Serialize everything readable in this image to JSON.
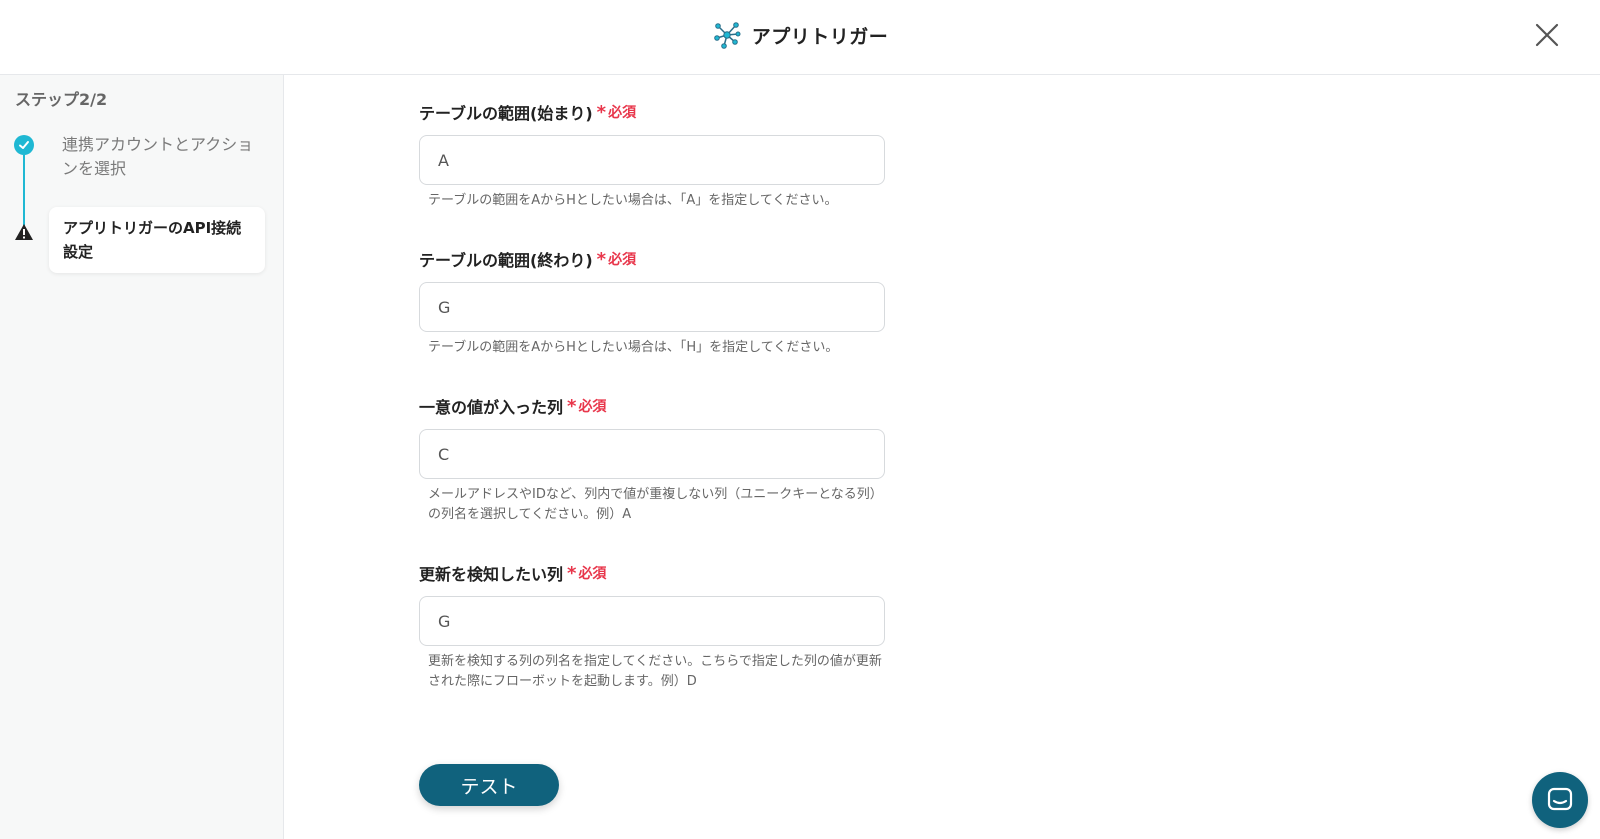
{
  "header": {
    "title": "アプリトリガー",
    "icon": "network-nodes-icon",
    "close_icon": "close-icon"
  },
  "sidebar": {
    "step_label": "ステップ2/2",
    "steps": [
      {
        "label": "連携アカウントとアクションを選択",
        "status": "done",
        "icon": "check-icon"
      },
      {
        "label": "アプリトリガーのAPI接続設定",
        "status": "active",
        "icon": "warning-icon"
      }
    ]
  },
  "form": {
    "required_mark": "*",
    "required_text": "必須",
    "fields": [
      {
        "label": "テーブルの範囲(始まり)",
        "value": "A",
        "hint": "テーブルの範囲をAからHとしたい場合は、「A」を指定してください。"
      },
      {
        "label": "テーブルの範囲(終わり)",
        "value": "G",
        "hint": "テーブルの範囲をAからHとしたい場合は、「H」を指定してください。"
      },
      {
        "label": "一意の値が入った列",
        "value": "C",
        "hint": "メールアドレスやIDなど、列内で値が重複しない列（ユニークキーとなる列）の列名を選択してください。例）A"
      },
      {
        "label": "更新を検知したい列",
        "value": "G",
        "hint": "更新を検知する列の列名を指定してください。こちらで指定した列の値が更新された際にフローボットを起動します。例）D"
      }
    ],
    "test_button": "テスト"
  },
  "chat": {
    "icon": "chat-icon"
  },
  "colors": {
    "accent": "#1fb8d3",
    "primary_button": "#10627d",
    "required": "#e8364b"
  }
}
